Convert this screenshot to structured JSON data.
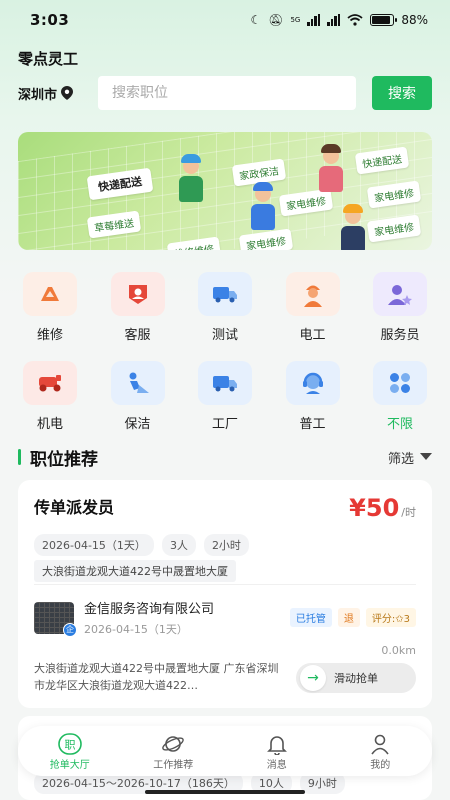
{
  "status_bar": {
    "time": "3:03",
    "network": "5G",
    "battery": "88%",
    "battery_level": 0.88
  },
  "app_title": "零点灵工",
  "search": {
    "city": "深圳市",
    "placeholder": "搜索职位",
    "button": "搜索"
  },
  "banner": {
    "tags": [
      "快递配送",
      "家政保洁",
      "快递配送",
      "草莓维送",
      "家电维修",
      "家电维修",
      "维修维修",
      "家电维修",
      "家电维修"
    ]
  },
  "categories": [
    {
      "label": "维修",
      "icon": "wrench-icon",
      "bg": "#fdeee6",
      "color": "#f07a3a"
    },
    {
      "label": "客服",
      "icon": "customer-service-icon",
      "bg": "#fde9e6",
      "color": "#e5483a"
    },
    {
      "label": "测试",
      "icon": "truck-icon",
      "bg": "#e6f0fd",
      "color": "#3b82e6"
    },
    {
      "label": "电工",
      "icon": "worker-icon",
      "bg": "#fdeee6",
      "color": "#f07a3a"
    },
    {
      "label": "服务员",
      "icon": "user-star-icon",
      "bg": "#eeeafd",
      "color": "#7b68d8"
    },
    {
      "label": "机电",
      "icon": "scooter-icon",
      "bg": "#fde9e6",
      "color": "#e5483a"
    },
    {
      "label": "保洁",
      "icon": "cleaner-icon",
      "bg": "#e6f0fd",
      "color": "#3b82e6"
    },
    {
      "label": "工厂",
      "icon": "truck-icon",
      "bg": "#e6f0fd",
      "color": "#3b82e6"
    },
    {
      "label": "普工",
      "icon": "headset-icon",
      "bg": "#e6f0fd",
      "color": "#3b82e6"
    },
    {
      "label": "不限",
      "icon": "clover-icon",
      "bg": "#e6f0fd",
      "color": "#3b82e6"
    }
  ],
  "section": {
    "title": "职位推荐",
    "filter": "筛选"
  },
  "job": {
    "title": "传单派发员",
    "salary": "¥50",
    "salary_unit": "/时",
    "chips": [
      "2026-04-15（1天）",
      "3人",
      "2小时"
    ],
    "address": "大浪街道龙观大道422号中晟置地大厦",
    "company": "金信服务咨询有限公司",
    "company_date": "2026-04-15（1天）",
    "company_badge": "企",
    "tags": {
      "escrow": "已托管",
      "refund": "退",
      "score": "评分:✩3"
    },
    "distance": "0.0km",
    "full_address": "大浪街道龙观大道422号中晟置地大厦 广东省深圳市龙华区大浪街道龙观大道422…",
    "grab": "滑动抢单"
  },
  "job2": {
    "chips": [
      "2026-04-15～2026-10-17（186天）",
      "10人",
      "9小时"
    ]
  },
  "tabbar": [
    {
      "label": "抢单大厅",
      "icon": "hall-icon",
      "glyph": "职",
      "active": true
    },
    {
      "label": "工作推荐",
      "icon": "planet-icon",
      "active": false
    },
    {
      "label": "消息",
      "icon": "bell-icon",
      "active": false
    },
    {
      "label": "我的",
      "icon": "user-icon",
      "active": false
    }
  ],
  "colors": {
    "accent": "#1fba5f",
    "salary": "#e53935"
  }
}
